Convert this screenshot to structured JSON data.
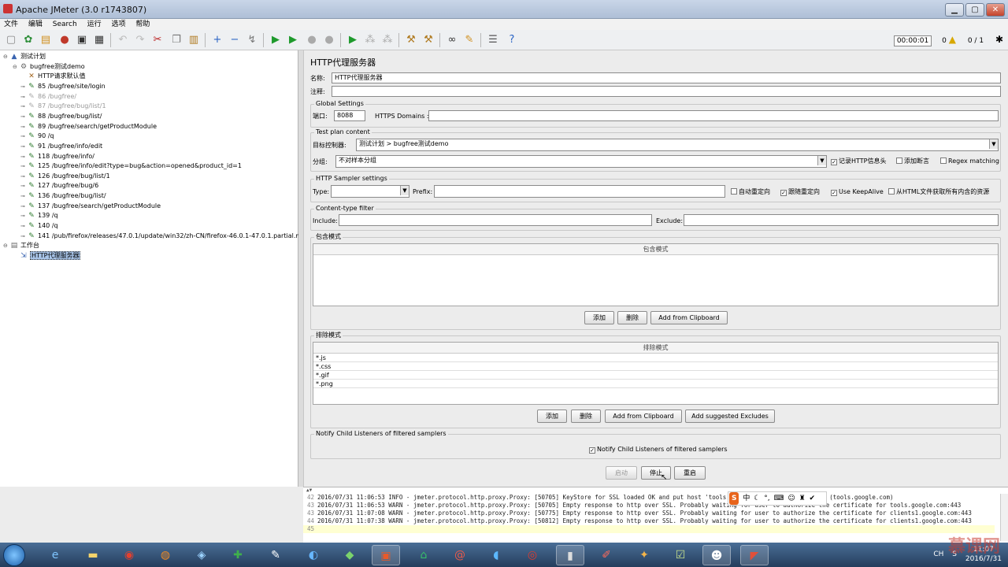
{
  "window": {
    "title": "Apache JMeter (3.0 r1743807)",
    "min": "▁",
    "max": "▢",
    "close": "✕"
  },
  "menu": [
    "文件",
    "编辑",
    "Search",
    "运行",
    "选项",
    "帮助"
  ],
  "toolbar_status": {
    "timer": "00:00:01",
    "warnings": "0",
    "threads": "0 / 1"
  },
  "tree": {
    "nodes": [
      {
        "label": "测试计划",
        "icon": "flask-icon",
        "disabled": false
      },
      {
        "label": "bugfree测试demo",
        "icon": "gear-icon",
        "disabled": false
      },
      {
        "label": "HTTP请求默认值",
        "icon": "wrench-icon",
        "disabled": false
      },
      {
        "label": "85 /bugfree/site/login",
        "icon": "sampler-icon",
        "disabled": false
      },
      {
        "label": "86 /bugfree/",
        "icon": "sampler-icon",
        "disabled": true
      },
      {
        "label": "87 /bugfree/bug/list/1",
        "icon": "sampler-icon",
        "disabled": true
      },
      {
        "label": "88 /bugfree/bug/list/",
        "icon": "sampler-icon",
        "disabled": false
      },
      {
        "label": "89 /bugfree/search/getProductModule",
        "icon": "sampler-icon",
        "disabled": false
      },
      {
        "label": "90 /q",
        "icon": "sampler-icon",
        "disabled": false
      },
      {
        "label": "91 /bugfree/info/edit",
        "icon": "sampler-icon",
        "disabled": false
      },
      {
        "label": "118 /bugfree/info/",
        "icon": "sampler-icon",
        "disabled": false
      },
      {
        "label": "125 /bugfree/info/edit?type=bug&action=opened&product_id=1",
        "icon": "sampler-icon",
        "disabled": false
      },
      {
        "label": "126 /bugfree/bug/list/1",
        "icon": "sampler-icon",
        "disabled": false
      },
      {
        "label": "127 /bugfree/bug/6",
        "icon": "sampler-icon",
        "disabled": false
      },
      {
        "label": "136 /bugfree/bug/list/",
        "icon": "sampler-icon",
        "disabled": false
      },
      {
        "label": "137 /bugfree/search/getProductModule",
        "icon": "sampler-icon",
        "disabled": false
      },
      {
        "label": "139 /q",
        "icon": "sampler-icon",
        "disabled": false
      },
      {
        "label": "140 /q",
        "icon": "sampler-icon",
        "disabled": false
      },
      {
        "label": "141 /pub/firefox/releases/47.0.1/update/win32/zh-CN/firefox-46.0.1-47.0.1.partial.mar",
        "icon": "sampler-icon",
        "disabled": false
      },
      {
        "label": "工作台",
        "icon": "workbench-icon",
        "disabled": false
      },
      {
        "label": "HTTP代理服务器",
        "icon": "proxy-icon",
        "disabled": false,
        "selected": true
      }
    ]
  },
  "panel": {
    "title": "HTTP代理服务器",
    "name_label": "名称:",
    "name_value": "HTTP代理服务器",
    "comment_label": "注释:",
    "global": {
      "title": "Global Settings",
      "port_label": "端口:",
      "port_value": "8088",
      "https_label": "HTTPS Domains :",
      "https_value": ""
    },
    "plan": {
      "title": "Test plan content",
      "target_label": "目标控制器:",
      "target_value": "测试计划 > bugfree测试demo",
      "group_label": "分组:",
      "group_value": "不对样本分组",
      "record_headers": "记录HTTP信息头",
      "add_assert": "添加断言",
      "regex": "Regex matching"
    },
    "sampler": {
      "title": "HTTP Sampler settings",
      "type_label": "Type:",
      "type_value": "",
      "prefix_label": "Prefix:",
      "prefix_value": "",
      "auto_redirect": "自动重定向",
      "follow_redirect": "跟随重定向",
      "keepalive": "Use KeepAlive",
      "embedded": "从HTML文件获取所有内含的资源"
    },
    "content_filter": {
      "title": "Content-type filter",
      "include_label": "Include:",
      "include_value": "",
      "exclude_label": "Exclude:",
      "exclude_value": ""
    },
    "include": {
      "title": "包含模式",
      "header": "包含模式",
      "rows": [],
      "add": "添加",
      "delete": "删除",
      "clipboard": "Add from Clipboard"
    },
    "exclude": {
      "title": "排除模式",
      "header": "排除模式",
      "rows": [
        "*.js",
        "*.css",
        "*.gif",
        "*.png"
      ],
      "add": "添加",
      "delete": "删除",
      "clipboard": "Add from Clipboard",
      "suggested": "Add suggested Excludes"
    },
    "notify": {
      "title": "Notify Child Listeners of filtered samplers",
      "checkbox": "Notify Child Listeners of filtered samplers"
    },
    "buttons": {
      "start": "启动",
      "stop": "停止",
      "restart": "重启"
    }
  },
  "log": {
    "lines": [
      {
        "no": "42",
        "text": "2016/07/31 11:06:53 INFO  - jmeter.protocol.http.proxy.Proxy: [50705] KeyStore for SSL loaded OK and put host 'tools.google.com' in map with key (tools.google.com)"
      },
      {
        "no": "43",
        "text": "2016/07/31 11:06:53 WARN  - jmeter.protocol.http.proxy.Proxy: [50705] Empty response to http over SSL. Probably waiting for user to authorize the certificate for tools.google.com:443"
      },
      {
        "no": "43",
        "text": "2016/07/31 11:07:08 WARN  - jmeter.protocol.http.proxy.Proxy: [50775] Empty response to http over SSL. Probably waiting for user to authorize the certificate for clients1.google.com:443"
      },
      {
        "no": "44",
        "text": "2016/07/31 11:07:38 WARN  - jmeter.protocol.http.proxy.Proxy: [50812] Empty response to http over SSL. Probably waiting for user to authorize the certificate for clients1.google.com:443"
      },
      {
        "no": "45",
        "text": ""
      }
    ]
  },
  "ime": {
    "s": "S",
    "zh": "中"
  },
  "taskbar": {
    "lang": "CH",
    "time": "11:07",
    "date": "2016/7/31",
    "watermark": "慕课网"
  }
}
